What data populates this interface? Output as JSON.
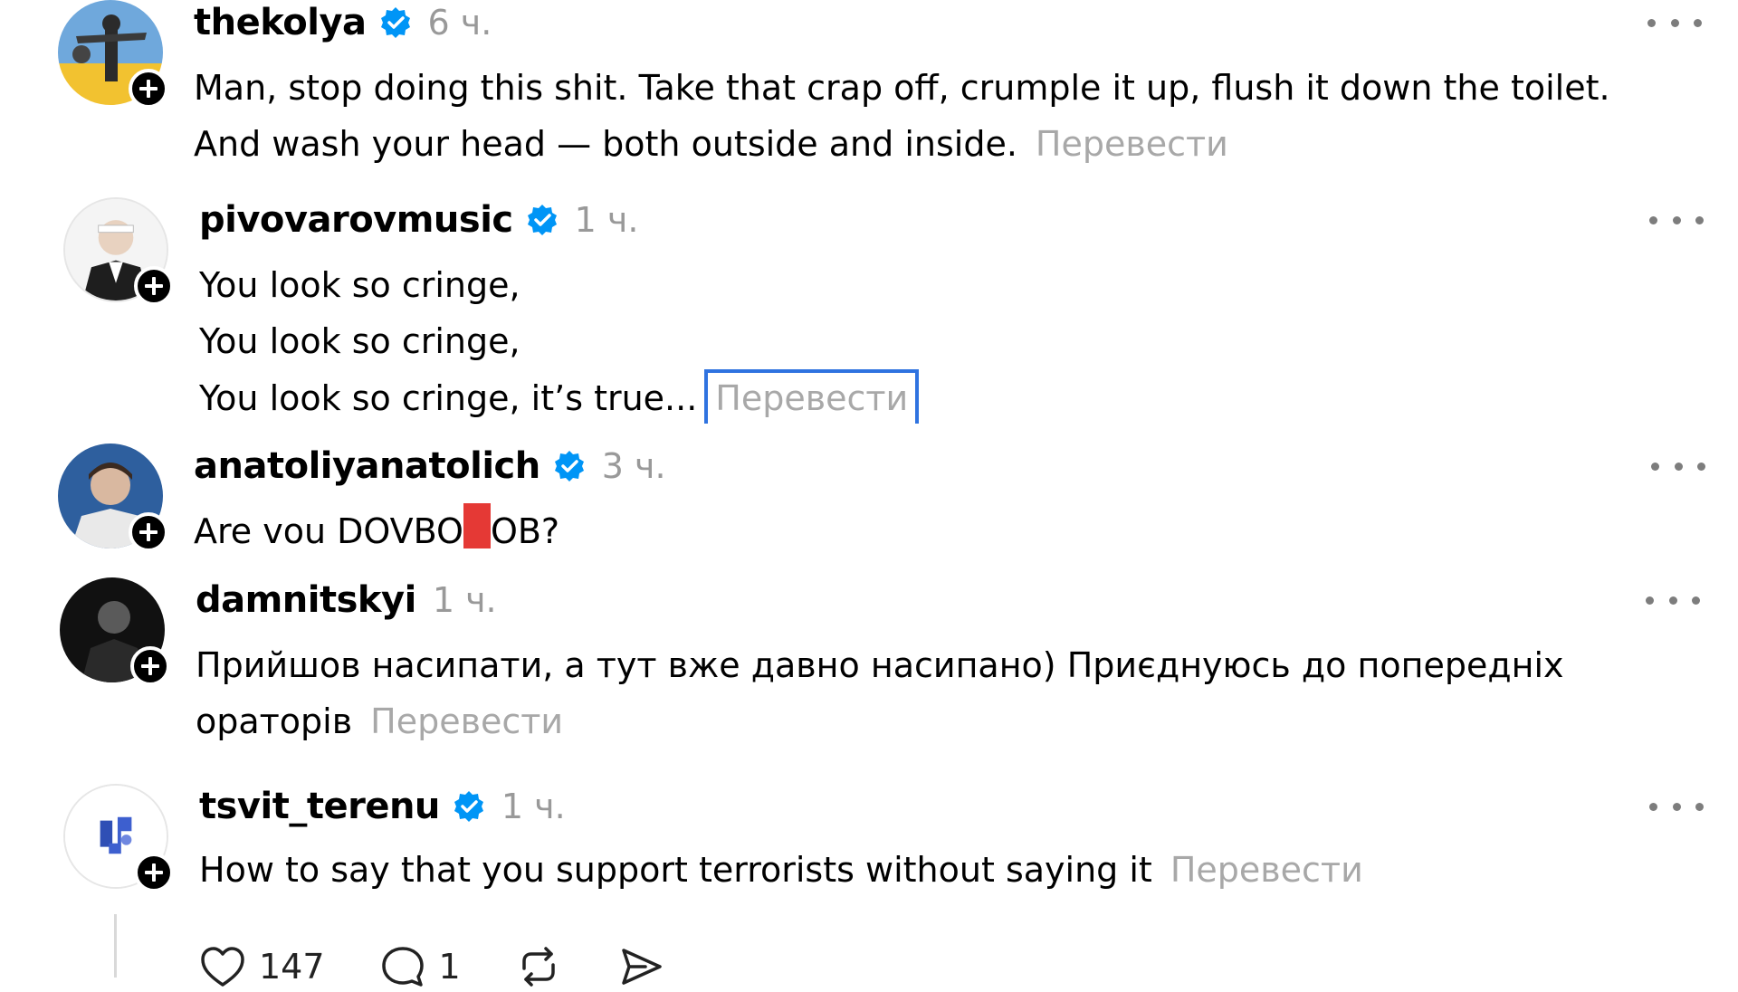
{
  "translate_label": "Перевести",
  "comments": [
    {
      "username": "thekolya",
      "verified": true,
      "time": "6 ч.",
      "lines": [
        "Man, stop doing this shit. Take that crap off, crumple it up, flush it down the toilet.",
        "And wash your head — both outside and inside."
      ]
    },
    {
      "username": "pivovarovmusic",
      "verified": true,
      "time": "1 ч.",
      "lines": [
        "You look so cringe,",
        "You look so cringe,",
        "You look so cringe, it’s true..."
      ]
    },
    {
      "username": "anatoliyanatolich",
      "verified": true,
      "time": "3 ч.",
      "text_before": "Are vou DOVBO",
      "text_after": "OB?"
    },
    {
      "username": "damnitskyi",
      "verified": false,
      "time": "1 ч.",
      "lines": [
        "Прийшов насипати, а тут вже давно насипано) Приєднуюсь до попередніх",
        "ораторів"
      ]
    },
    {
      "username": "tsvit_terenu",
      "verified": true,
      "time": "1 ч.",
      "lines": [
        "How to say that you support terrorists without saying it"
      ]
    }
  ],
  "actions": {
    "likes": "147",
    "replies": "1"
  },
  "colors": {
    "verified": "#0095f6",
    "redaction": "#e53935",
    "focus_ring": "#2f73e0",
    "muted_text": "#999999"
  },
  "icons": [
    "plus-icon",
    "verified-icon",
    "more-icon",
    "heart-icon",
    "comment-icon",
    "repost-icon",
    "share-icon"
  ]
}
